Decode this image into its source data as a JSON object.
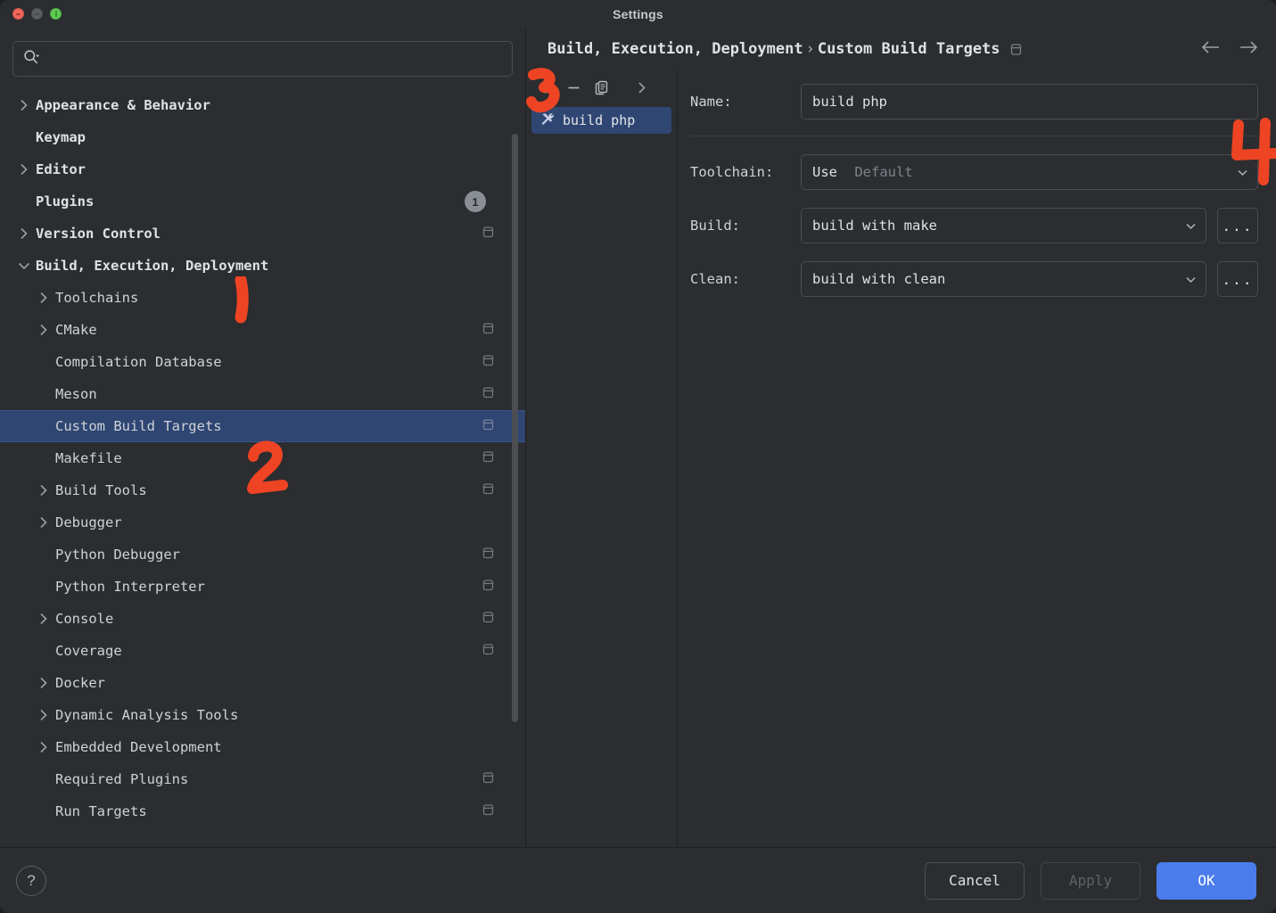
{
  "window": {
    "title": "Settings",
    "traffic_lights": [
      "close-red",
      "minimize-yellow",
      "zoom-green"
    ]
  },
  "sidebar": {
    "search": {
      "value": "",
      "placeholder": "",
      "icon": "search-icon"
    },
    "items": [
      {
        "label": "Appearance & Behavior",
        "level": 0,
        "bold": true,
        "arrow": "right",
        "badge": null,
        "scope": false,
        "selected": false
      },
      {
        "label": "Keymap",
        "level": 0,
        "bold": true,
        "arrow": "none",
        "badge": null,
        "scope": false,
        "selected": false
      },
      {
        "label": "Editor",
        "level": 0,
        "bold": true,
        "arrow": "right",
        "badge": null,
        "scope": false,
        "selected": false
      },
      {
        "label": "Plugins",
        "level": 0,
        "bold": true,
        "arrow": "none",
        "badge": "1",
        "scope": false,
        "selected": false
      },
      {
        "label": "Version Control",
        "level": 0,
        "bold": true,
        "arrow": "right",
        "badge": null,
        "scope": true,
        "selected": false
      },
      {
        "label": "Build, Execution, Deployment",
        "level": 0,
        "bold": true,
        "arrow": "down",
        "badge": null,
        "scope": false,
        "selected": false
      },
      {
        "label": "Toolchains",
        "level": 1,
        "bold": false,
        "arrow": "right",
        "badge": null,
        "scope": false,
        "selected": false
      },
      {
        "label": "CMake",
        "level": 1,
        "bold": false,
        "arrow": "right",
        "badge": null,
        "scope": true,
        "selected": false
      },
      {
        "label": "Compilation Database",
        "level": 1,
        "bold": false,
        "arrow": "none",
        "badge": null,
        "scope": true,
        "selected": false
      },
      {
        "label": "Meson",
        "level": 1,
        "bold": false,
        "arrow": "none",
        "badge": null,
        "scope": true,
        "selected": false
      },
      {
        "label": "Custom Build Targets",
        "level": 1,
        "bold": false,
        "arrow": "none",
        "badge": null,
        "scope": true,
        "selected": true
      },
      {
        "label": "Makefile",
        "level": 1,
        "bold": false,
        "arrow": "none",
        "badge": null,
        "scope": true,
        "selected": false
      },
      {
        "label": "Build Tools",
        "level": 1,
        "bold": false,
        "arrow": "right",
        "badge": null,
        "scope": true,
        "selected": false
      },
      {
        "label": "Debugger",
        "level": 1,
        "bold": false,
        "arrow": "right",
        "badge": null,
        "scope": false,
        "selected": false
      },
      {
        "label": "Python Debugger",
        "level": 1,
        "bold": false,
        "arrow": "none",
        "badge": null,
        "scope": true,
        "selected": false
      },
      {
        "label": "Python Interpreter",
        "level": 1,
        "bold": false,
        "arrow": "none",
        "badge": null,
        "scope": true,
        "selected": false
      },
      {
        "label": "Console",
        "level": 1,
        "bold": false,
        "arrow": "right",
        "badge": null,
        "scope": true,
        "selected": false
      },
      {
        "label": "Coverage",
        "level": 1,
        "bold": false,
        "arrow": "none",
        "badge": null,
        "scope": true,
        "selected": false
      },
      {
        "label": "Docker",
        "level": 1,
        "bold": false,
        "arrow": "right",
        "badge": null,
        "scope": false,
        "selected": false
      },
      {
        "label": "Dynamic Analysis Tools",
        "level": 1,
        "bold": false,
        "arrow": "right",
        "badge": null,
        "scope": false,
        "selected": false
      },
      {
        "label": "Embedded Development",
        "level": 1,
        "bold": false,
        "arrow": "right",
        "badge": null,
        "scope": false,
        "selected": false
      },
      {
        "label": "Required Plugins",
        "level": 1,
        "bold": false,
        "arrow": "none",
        "badge": null,
        "scope": true,
        "selected": false
      },
      {
        "label": "Run Targets",
        "level": 1,
        "bold": false,
        "arrow": "none",
        "badge": null,
        "scope": true,
        "selected": false
      }
    ]
  },
  "breadcrumb": {
    "parent": "Build, Execution, Deployment",
    "separator": "›",
    "current": "Custom Build Targets",
    "scope_icon": "project-scope-icon",
    "back_icon": "arrow-left-icon",
    "forward_icon": "arrow-right-icon"
  },
  "targets_panel": {
    "toolbar": [
      {
        "name": "add-target-button",
        "icon": "plus-icon"
      },
      {
        "name": "remove-target-button",
        "icon": "minus-icon"
      },
      {
        "name": "copy-target-button",
        "icon": "copy-icon"
      },
      {
        "name": "expand-panel-button",
        "icon": "chevron-right-icon"
      }
    ],
    "items": [
      {
        "label": "build php",
        "icon": "tools-icon",
        "selected": true
      }
    ]
  },
  "form": {
    "name_label": "Name:",
    "name_value": "build php",
    "toolchain_label": "Toolchain:",
    "toolchain_prefix": "Use",
    "toolchain_value": "Default",
    "build_label": "Build:",
    "build_value": "build with make",
    "build_browse": "...",
    "clean_label": "Clean:",
    "clean_value": "build with clean",
    "clean_browse": "..."
  },
  "footer": {
    "help_label": "?",
    "cancel_label": "Cancel",
    "apply_label": "Apply",
    "apply_disabled": true,
    "ok_label": "OK"
  },
  "annotations": [
    {
      "label": "1",
      "target": "sidebar-item-build-execution-deployment"
    },
    {
      "label": "2",
      "target": "sidebar-item-custom-build-targets"
    },
    {
      "label": "3",
      "target": "add-target-button"
    },
    {
      "label": "4",
      "target": "build-browse-button"
    }
  ],
  "colors": {
    "window_bg": "#2b2d30",
    "selection_blue": "#2f4673",
    "accent_primary": "#4a7ceb",
    "annotation_red": "#ef4424",
    "text": "#dfe1e5",
    "text_muted": "#7e838a"
  }
}
